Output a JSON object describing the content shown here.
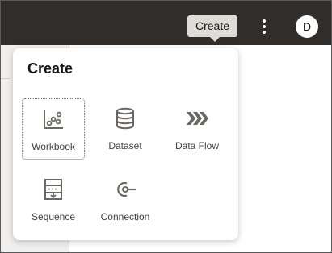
{
  "header": {
    "create_label": "Create",
    "avatar_initial": "D"
  },
  "create_menu": {
    "title": "Create",
    "items": [
      {
        "label": "Workbook",
        "icon": "workbook-icon"
      },
      {
        "label": "Dataset",
        "icon": "dataset-icon"
      },
      {
        "label": "Data Flow",
        "icon": "data-flow-icon"
      },
      {
        "label": "Sequence",
        "icon": "sequence-icon"
      },
      {
        "label": "Connection",
        "icon": "connection-icon"
      }
    ]
  },
  "colors": {
    "topbar": "#312d2a",
    "button": "#dfdcd8",
    "icon": "#6b6763",
    "text": "#161513"
  }
}
